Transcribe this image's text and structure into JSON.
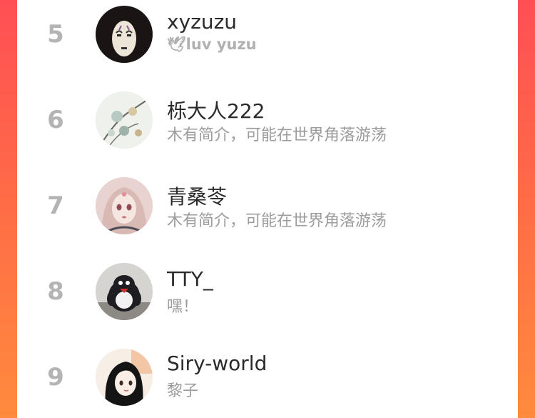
{
  "colors": {
    "background_top": "#ff4f55",
    "background_bottom": "#ff8b3d",
    "card": "#ffffff",
    "rank_text": "#b4b4b4",
    "name_text": "#2a2a2a",
    "bio_text": "#9c9c9c"
  },
  "users": [
    {
      "rank": "5",
      "name": "xyzuzu",
      "bio": "🕊luv yuzu",
      "avatar_icon": "no-face-avatar"
    },
    {
      "rank": "6",
      "name": "栎大人222",
      "bio": "木有简介，可能在世界角落游荡",
      "avatar_icon": "floral-illustration-avatar"
    },
    {
      "rank": "7",
      "name": "青桑苓",
      "bio": "木有简介，可能在世界角落游荡",
      "avatar_icon": "anime-girl-avatar"
    },
    {
      "rank": "8",
      "name": "TTY_",
      "bio": "嘿！",
      "avatar_icon": "penguin-plush-avatar"
    },
    {
      "rank": "9",
      "name": "Siry-world",
      "bio": "黎子",
      "avatar_icon": "anime-girl-dark-hair-avatar"
    }
  ]
}
